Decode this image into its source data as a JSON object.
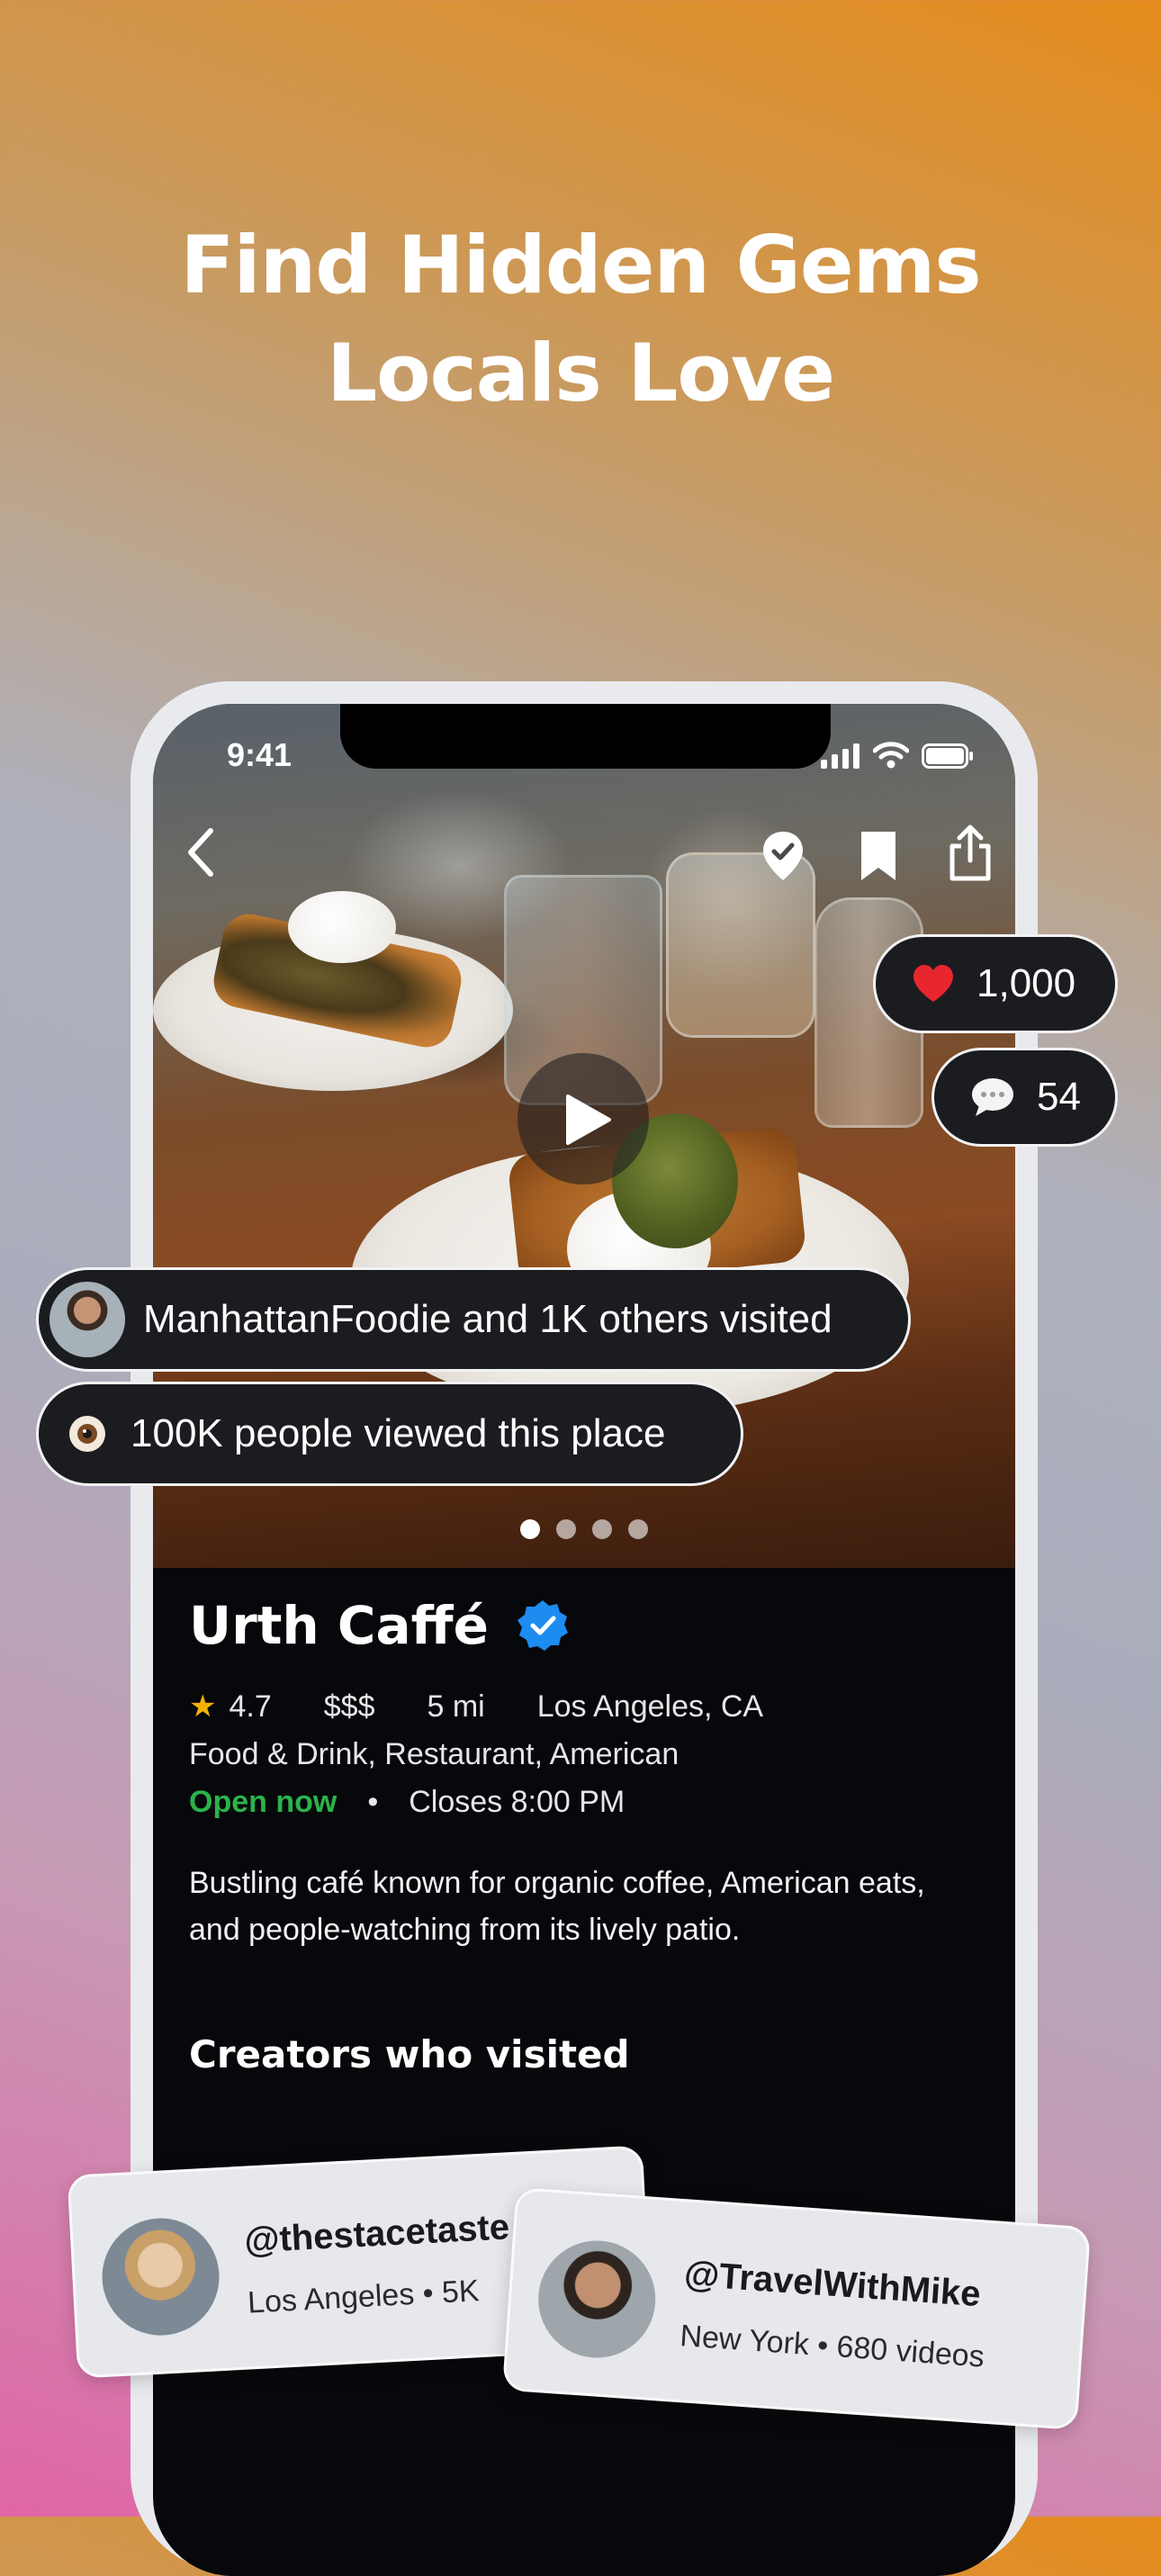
{
  "headline": {
    "line1": "Find Hidden Gems",
    "line2": "Locals Love"
  },
  "status_bar": {
    "time": "9:41"
  },
  "stats": {
    "likes": "1,000",
    "comments": "54"
  },
  "social_proof": {
    "visited_text": "ManhattanFoodie and 1K others visited",
    "views_text": "100K people viewed this place"
  },
  "carousel": {
    "total": 4,
    "active": 1
  },
  "place": {
    "name": "Urth Caffé",
    "rating": "4.7",
    "price": "$$$",
    "distance": "5 mi",
    "location": "Los Angeles, CA",
    "categories": "Food & Drink, Restaurant, American",
    "open_status": "Open now",
    "separator": "•",
    "closes": "Closes 8:00 PM",
    "description": "Bustling café known for organic coffee, American eats, and people-watching from its lively patio."
  },
  "creators_section": {
    "title": "Creators who visited"
  },
  "creators": [
    {
      "handle": "@thestacetaste",
      "subtitle": "Los Angeles • 5K"
    },
    {
      "handle": "@TravelWithMike",
      "subtitle": "New York • 680 videos"
    }
  ],
  "colors": {
    "open_green": "#2bb34a",
    "verified_blue": "#1d8cf0",
    "star": "#f5b301",
    "heart": "#e8262e"
  }
}
